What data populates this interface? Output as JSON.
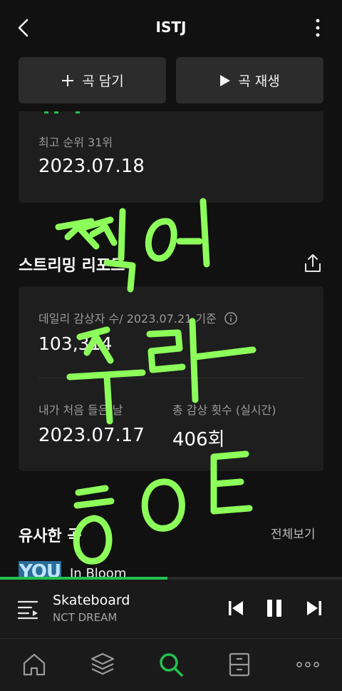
{
  "header": {
    "title": "ISTJ",
    "back_icon": "chevron-left-icon",
    "more_icon": "more-vertical-icon"
  },
  "actions": {
    "add_label": "곡 담기",
    "play_label": "곡 재생"
  },
  "rank": {
    "label": "최고 순위 31위",
    "date": "2023.07.18",
    "graph_color": "#23c14f"
  },
  "stream_report": {
    "title": "스트리밍 리포트",
    "daily_listeners_label": "데일리 감상자 수/ 2023.07.21 기준",
    "daily_listeners_value": "103,314",
    "first_listen_label": "내가 처음 들은 날",
    "first_listen_value": "2023.07.17",
    "total_plays_label": "총 감상 횟수 (실시간)",
    "total_plays_value": "406회"
  },
  "similar": {
    "title": "유사한 곡",
    "see_all": "전체보기",
    "first_item_title": "In Bloom",
    "first_item_thumb_text": "YOU"
  },
  "player": {
    "title": "Skateboard",
    "artist": "NCT DREAM",
    "progress": 0.49,
    "accent": "#23c14f"
  },
  "nav": {
    "items": [
      "home-icon",
      "library-icon",
      "search-icon",
      "storage-icon",
      "more-horizontal-icon"
    ],
    "active": "search-icon"
  },
  "overlay": {
    "handwriting_color": "#8cff5a"
  }
}
